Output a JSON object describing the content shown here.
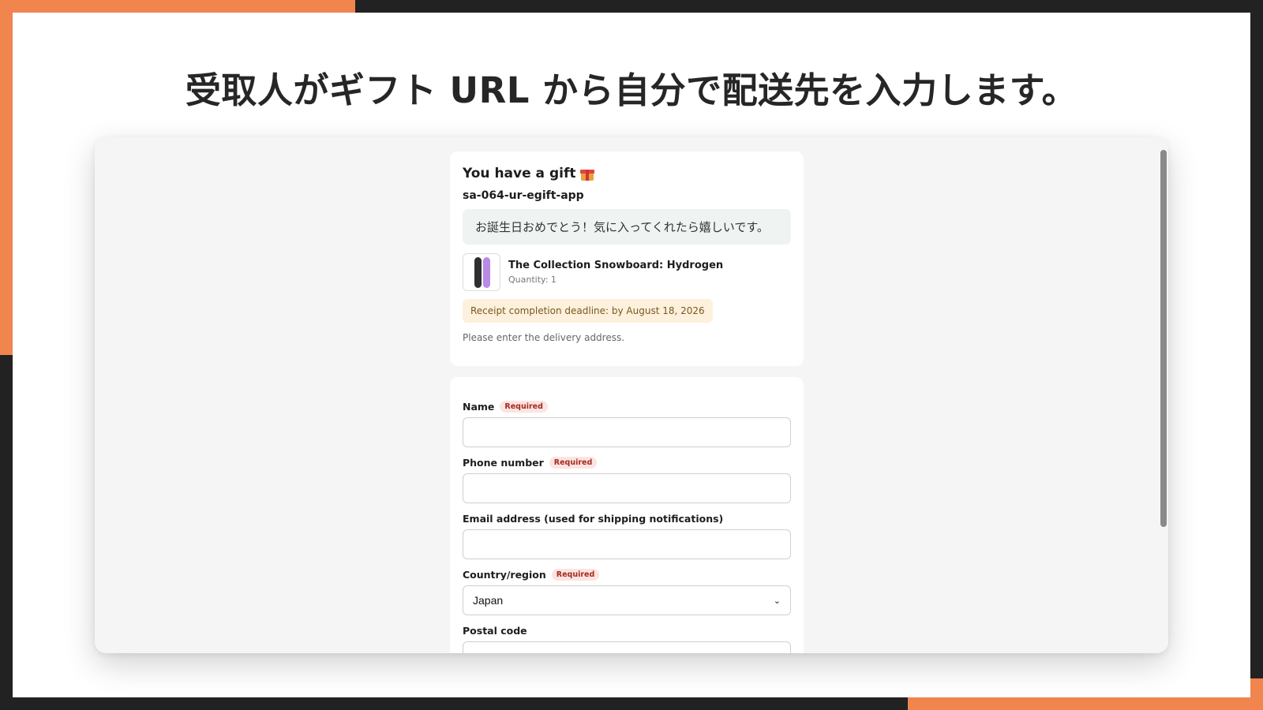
{
  "headline": "受取人がギフト URL から自分で配送先を入力します。",
  "gift": {
    "title": "You have a gift",
    "icon": "gift-icon",
    "store": "sa-064-ur-egift-app",
    "message": "お誕生日おめでとう！気に入ってくれたら嬉しいです。",
    "product": {
      "name": "The Collection Snowboard: Hydrogen",
      "quantity": "Quantity: 1"
    },
    "deadline": "Receipt completion deadline: by August 18, 2026",
    "hint": "Please enter the delivery address."
  },
  "form": {
    "required_badge": "Required",
    "name_label": "Name",
    "name_value": "",
    "phone_label": "Phone number",
    "phone_value": "",
    "email_label": "Email address (used for shipping notifications)",
    "email_value": "",
    "country_label": "Country/region",
    "country_value": "Japan",
    "postal_label": "Postal code",
    "postal_value": ""
  },
  "colors": {
    "accent": "#f0854e",
    "frame": "#222222",
    "required_bg": "#fbe4e1",
    "required_text": "#a42a1e",
    "deadline_bg": "#fdf0dc"
  }
}
